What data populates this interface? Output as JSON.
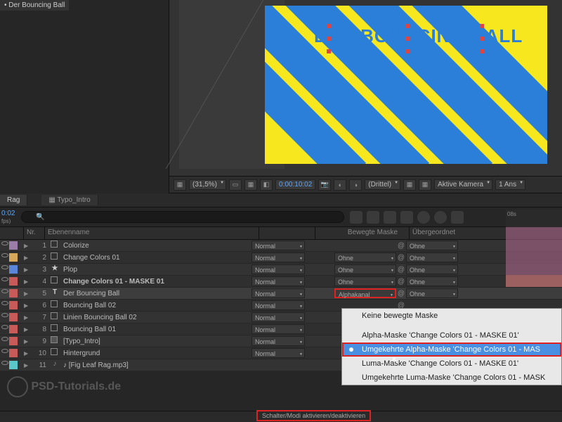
{
  "comp_panel": {
    "tab_label": "• Der Bouncing Ball"
  },
  "canvas": {
    "text": "DER BOUNCING BALL"
  },
  "viewer_toolbar": {
    "zoom": "(31,5%)",
    "timecode": "0:00:10:02",
    "view_mode": "(Drittel)",
    "camera": "Aktive Kamera",
    "views": "1 Ans"
  },
  "timeline": {
    "tabs": [
      "Rag",
      "Typo_Intro"
    ],
    "current_time": "0:02",
    "fps_label": "fps)",
    "ruler_label": "08s",
    "columns": {
      "nr": "Nr.",
      "name": "Ebenenname",
      "trkmat": "Bewegte Maske",
      "parent": "Übergeordnet"
    },
    "layers": [
      {
        "nr": "1",
        "name": "Colorize",
        "color": "#9a7da8",
        "mode": "Normal",
        "trkmat": "",
        "parent": "Ohne",
        "icon": "sq"
      },
      {
        "nr": "2",
        "name": "Change Colors 01",
        "color": "#d8a85a",
        "mode": "Normal",
        "trkmat": "Ohne",
        "parent": "Ohne",
        "icon": "sq"
      },
      {
        "nr": "3",
        "name": "Plop",
        "color": "#5a85d8",
        "mode": "Normal",
        "trkmat": "Ohne",
        "parent": "Ohne",
        "icon": "star"
      },
      {
        "nr": "4",
        "name": "Change Colors 01 - MASKE 01",
        "color": "#c85a5a",
        "mode": "Normal",
        "trkmat": "Ohne",
        "parent": "Ohne",
        "icon": "sq",
        "bold": true
      },
      {
        "nr": "5",
        "name": "Der Bouncing Ball",
        "color": "#c85a5a",
        "mode": "Normal",
        "trkmat": "Alphakanal",
        "parent": "Ohne",
        "icon": "T",
        "selected": true,
        "trkmat_hl": true
      },
      {
        "nr": "6",
        "name": "Bouncing Ball 02",
        "color": "#c85a5a",
        "mode": "Normal",
        "trkmat": "",
        "parent": "",
        "icon": "sq"
      },
      {
        "nr": "7",
        "name": "Linien Bouncing Ball 02",
        "color": "#c85a5a",
        "mode": "Normal",
        "trkmat": "",
        "parent": "",
        "icon": "sq"
      },
      {
        "nr": "8",
        "name": "Bouncing Ball 01",
        "color": "#c85a5a",
        "mode": "Normal",
        "trkmat": "",
        "parent": "",
        "icon": "sq"
      },
      {
        "nr": "9",
        "name": "[Typo_Intro]",
        "color": "#c85a5a",
        "mode": "Normal",
        "trkmat": "",
        "parent": "",
        "icon": "comp"
      },
      {
        "nr": "10",
        "name": "Hintergrund",
        "color": "#c85a5a",
        "mode": "Normal",
        "trkmat": "",
        "parent": "",
        "icon": "sq"
      },
      {
        "nr": "11",
        "name": "[Fig Leaf Rag.mp3]",
        "color": "#5ac8c8",
        "mode": "",
        "trkmat": "",
        "parent": "",
        "icon": "audio"
      }
    ]
  },
  "dropdown": {
    "items": [
      {
        "label": "Keine bewegte Maske"
      },
      {
        "label": "Alpha-Maske 'Change Colors 01 - MASKE 01'"
      },
      {
        "label": "Umgekehrte Alpha-Maske 'Change Colors 01 - MAS",
        "selected": true
      },
      {
        "label": "Luma-Maske 'Change Colors 01 - MASKE 01'"
      },
      {
        "label": "Umgekehrte Luma-Maske 'Change Colors 01 - MASK"
      }
    ]
  },
  "footer": {
    "toggle_label": "Schalter/Modi aktivieren/deaktivieren"
  },
  "watermark": "PSD-Tutorials.de"
}
